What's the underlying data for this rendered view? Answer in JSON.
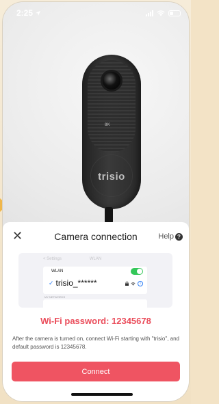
{
  "status_bar": {
    "time": "2:25",
    "location_icon": "location-arrow-icon",
    "signal_icon": "cellular-signal-icon",
    "wifi_icon": "wifi-icon",
    "battery_icon": "battery-icon"
  },
  "hero": {
    "camera_badge": "8K",
    "camera_brand": "trisio"
  },
  "sheet": {
    "close_glyph": "✕",
    "title": "Camera connection",
    "help_label": "Help",
    "help_glyph": "?",
    "wifi_screenshot": {
      "back_label": "< Settings",
      "nav_title": "WLAN",
      "wlan_label": "WLAN",
      "network_name": "trisio_******",
      "check_glyph": "✓",
      "lock_glyph": "🔒",
      "wifi_glyph": "≋",
      "info_glyph": "i",
      "section_label": "MY NETWORKS",
      "toggle_on": true
    },
    "password_text": "Wi-Fi password: 12345678",
    "hint_text": "After the camera is turned on, connect Wi-Fi starting with \"trisio\", and default password is 12345678.",
    "connect_label": "Connect"
  },
  "colors": {
    "accent_red": "#ef5462",
    "password_red": "#ea4c5a",
    "toggle_green": "#34c759",
    "link_blue": "#2a7cf6",
    "side_arrow": "#f0b74b"
  }
}
